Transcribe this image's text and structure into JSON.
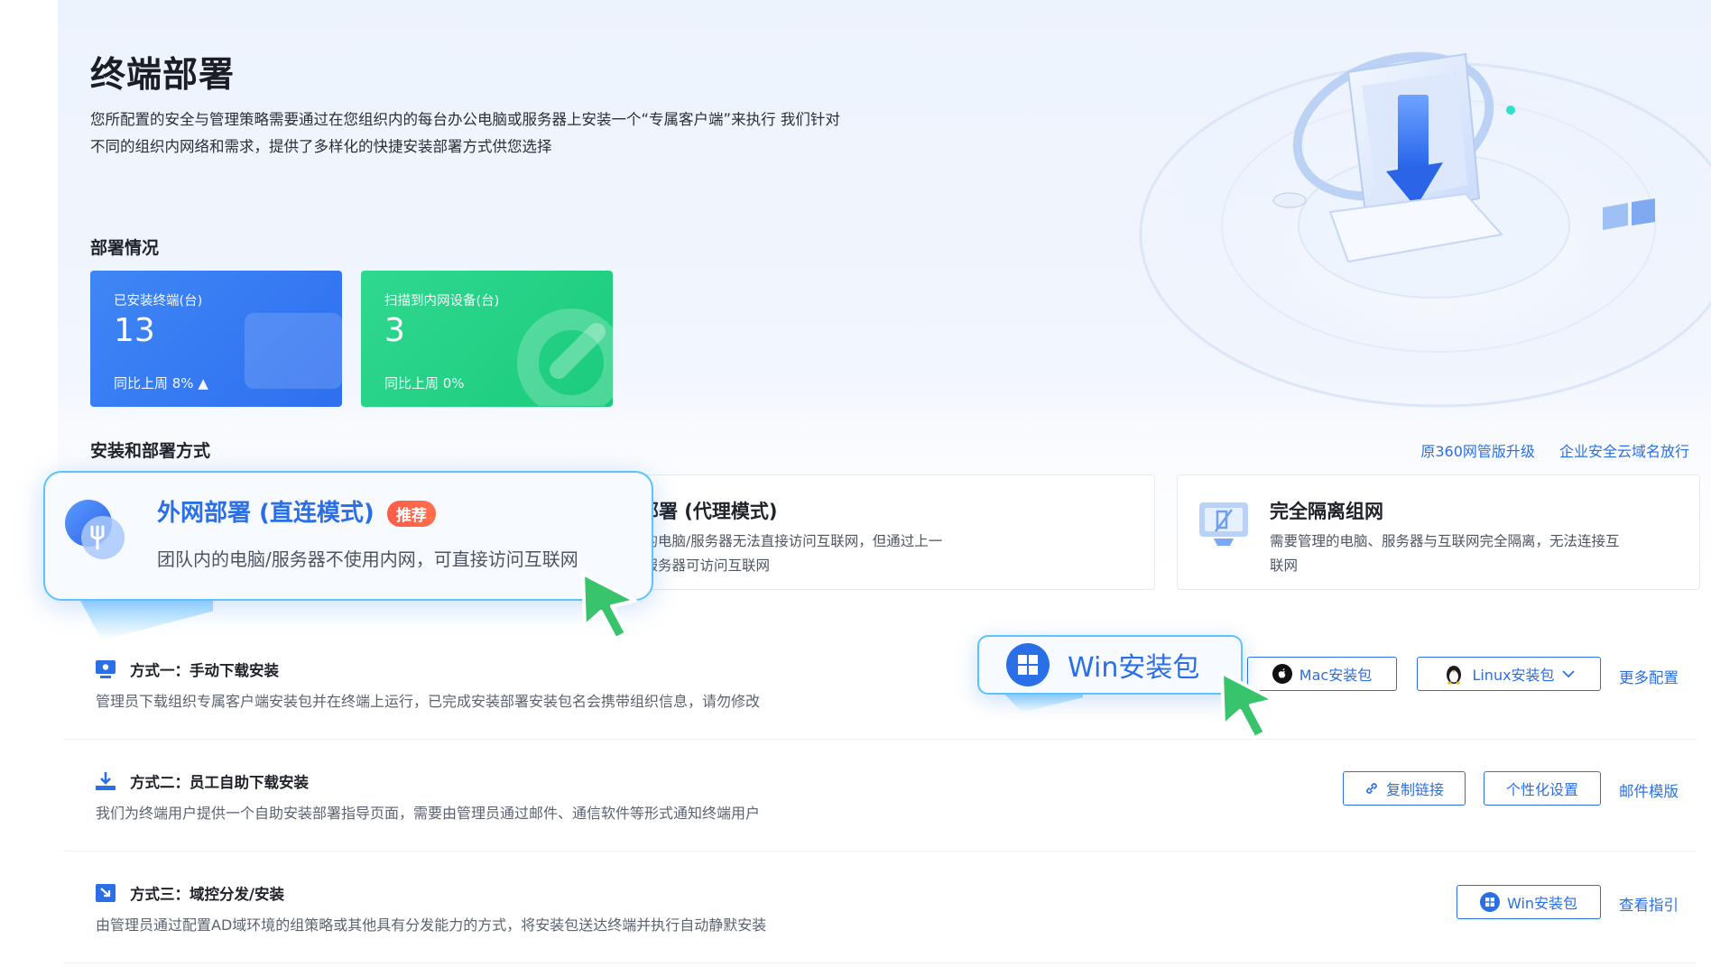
{
  "page": {
    "title": "终端部署",
    "description_line1": "您所配置的安全与管理策略需要通过在您组织内的每台办公电脑或服务器上安装一个“专属客户端”来执行 我们针对",
    "description_line2": "不同的组织内网络和需求，提供了多样化的快捷安装部署方式供您选择"
  },
  "status": {
    "section_title": "部署情况",
    "cards": [
      {
        "label": "已安装终端(台)",
        "value": "13",
        "trend": "同比上周 8% ▲",
        "color": "#3a7ff4"
      },
      {
        "label": "扫描到内网设备(台)",
        "value": "3",
        "trend": "同比上周 0%",
        "color": "#22d183"
      }
    ]
  },
  "install": {
    "section_title": "安装和部署方式",
    "links": [
      "原360网管版升级",
      "企业安全云域名放行"
    ],
    "modes": [
      {
        "title": "外网部署 (直连模式)",
        "badge": "推荐",
        "desc": "团队内的电脑/服务器不使用内网，可直接访问互联网",
        "selected": true
      },
      {
        "title": "内网部署 (代理模式)",
        "desc_line1": "团队内的电脑/服务器无法直接访问互联网，但通过上一",
        "desc_line2": "级内网服务器可访问互联网"
      },
      {
        "title": "完全隔离组网",
        "desc_line1": "需要管理的电脑、服务器与互联网完全隔离，无法连接互",
        "desc_line2": "联网"
      }
    ],
    "methods": [
      {
        "title": "方式一：手动下载安装",
        "desc": "管理员下载组织专属客户端安装包并在终端上运行，已完成安装部署安装包名会携带组织信息，请勿修改",
        "win_btn": "Win安装包",
        "mac_btn": "Mac安装包",
        "linux_btn": "Linux安装包",
        "link": "更多配置"
      },
      {
        "title": "方式二：员工自助下载安装",
        "desc": "我们为终端用户提供一个自助安装部署指导页面，需要由管理员通过邮件、通信软件等形式通知终端用户",
        "copy_btn": "复制链接",
        "custom_btn": "个性化设置",
        "link": "邮件模版"
      },
      {
        "title": "方式三：域控分发/安装",
        "desc": "由管理员通过配置AD域环境的组策略或其他具有分发能力的方式，将安装包送达终端并执行自动静默安装",
        "win_btn": "Win安装包",
        "link": "查看指引"
      }
    ]
  },
  "colors": {
    "accent": "#2b6fe6",
    "highlight_border": "#5cc3ff",
    "cursor": "#35c46a",
    "badge": "#ff5b49"
  }
}
